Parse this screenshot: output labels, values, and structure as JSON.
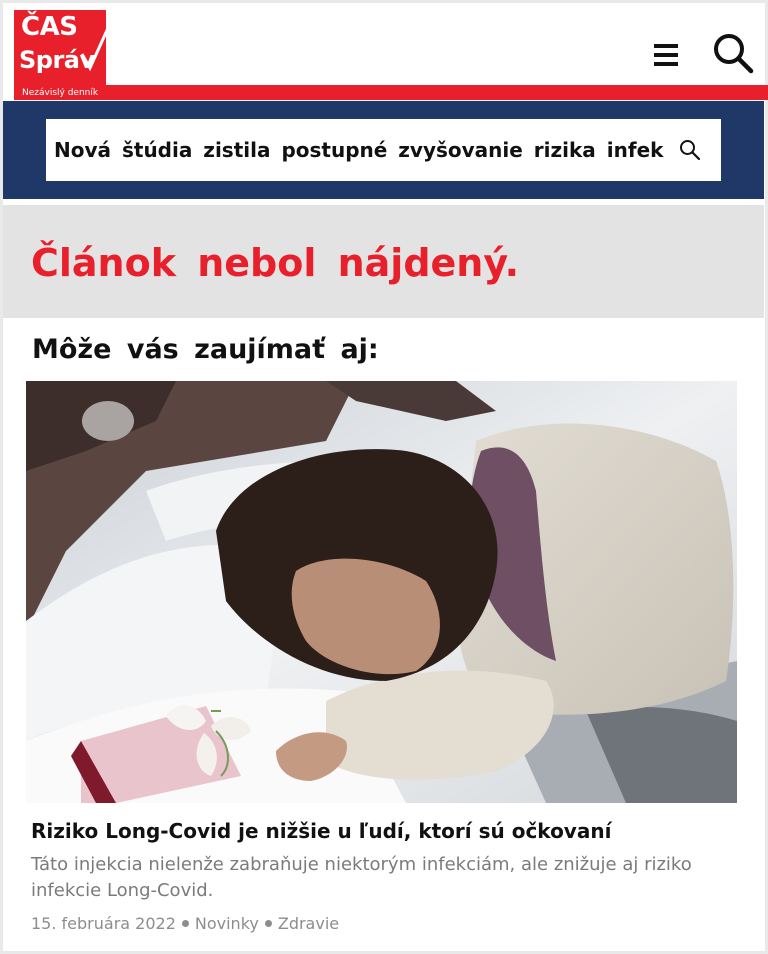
{
  "header": {
    "logo": {
      "line1": "ČAS",
      "line2": "Správ",
      "tagline": "Nezávislý denník"
    },
    "menu_icon": "hamburger-menu-icon",
    "search_icon": "search-icon"
  },
  "search": {
    "value": "Nová štúdia zistila postupné zvyšovanie rizika infek",
    "icon": "search-icon"
  },
  "notfound": {
    "message": "Článok nebol nájdený."
  },
  "suggestions": {
    "title": "Môže vás zaujímať aj:",
    "article": {
      "title": "Riziko Long-Covid je nižšie u ľudí, ktorí sú očkovaní",
      "description": "Táto injekcia nielenže zabraňuje niektorým infekciám, ale znižuje aj riziko infekcie Long-Covid.",
      "date": "15. februára 2022",
      "category1": "Novinky",
      "category2": "Zdravie"
    }
  },
  "colors": {
    "brand_red": "#e8202b",
    "navy": "#1f3867",
    "gray_bg": "#e3e3e3"
  }
}
